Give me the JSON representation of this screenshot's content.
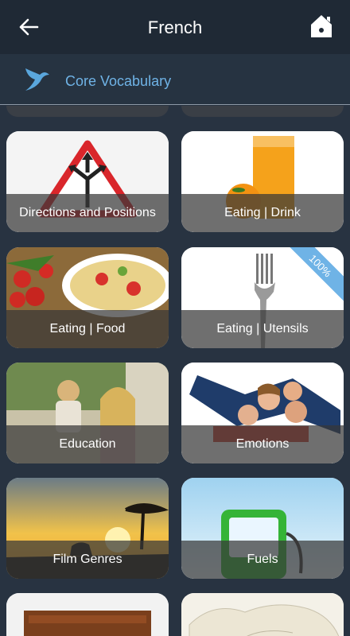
{
  "header": {
    "title": "French"
  },
  "subheader": {
    "title": "Core Vocabulary"
  },
  "icons": {
    "back": "back-arrow-icon",
    "home": "home-icon",
    "brand": "bird-logo-icon"
  },
  "colors": {
    "topbar": "#1f2935",
    "background": "#283341",
    "accent": "#6fb3e6"
  },
  "cards": [
    {
      "label": "Directions and Positions"
    },
    {
      "label": "Eating | Drink"
    },
    {
      "label": "Eating | Food"
    },
    {
      "label": "Eating | Utensils",
      "badge": "100%"
    },
    {
      "label": "Education"
    },
    {
      "label": "Emotions"
    },
    {
      "label": "Film Genres"
    },
    {
      "label": "Fuels"
    }
  ]
}
